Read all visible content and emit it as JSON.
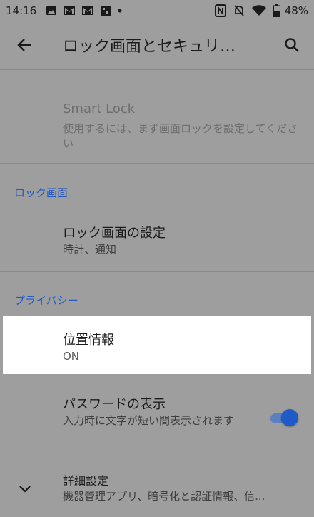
{
  "status_bar": {
    "time": "14:16",
    "battery": "48%",
    "icons_left": [
      "image-icon",
      "gmail-icon",
      "gmail-icon",
      "app-icon",
      "dot-icon"
    ],
    "icons_right": [
      "nfc-icon",
      "bell-off-icon",
      "wifi-icon",
      "battery-icon"
    ]
  },
  "app_bar": {
    "title": "ロック画面とセキュリ…",
    "back_icon": "arrow-back-icon",
    "search_icon": "search-icon"
  },
  "smart_lock": {
    "title": "Smart Lock",
    "subtitle": "使用するには、まず画面ロックを設定してください",
    "enabled": false
  },
  "sections": {
    "lock_screen": "ロック画面",
    "privacy": "プライバシー"
  },
  "lock_screen_settings": {
    "title": "ロック画面の設定",
    "subtitle": "時計、通知"
  },
  "location": {
    "title": "位置情報",
    "subtitle": "ON"
  },
  "show_passwords": {
    "title": "パスワードの表示",
    "subtitle": "入力時に文字が短い間表示されます",
    "toggle_on": true
  },
  "advanced": {
    "title": "詳細設定",
    "subtitle": "機器管理アプリ、暗号化と認証情報、信..."
  },
  "colors": {
    "overlay_background": "#9e9e9e",
    "highlight": "#ffffff",
    "accent": "#1e5ac8"
  }
}
